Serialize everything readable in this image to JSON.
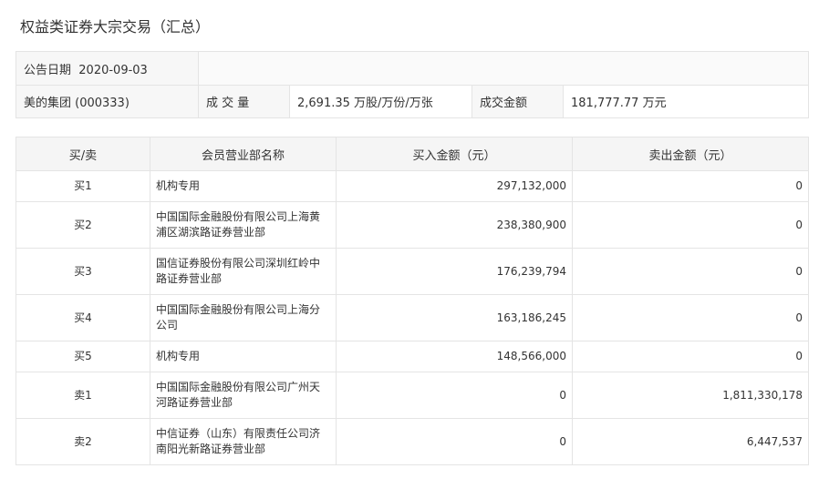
{
  "title": "权益类证券大宗交易（汇总）",
  "info": {
    "date_label": "公告日期",
    "date_value": "2020-09-03",
    "stock": "美的集团 (000333)",
    "volume_label": "成 交 量",
    "volume_value": "2,691.35 万股/万份/万张",
    "amount_label": "成交金额",
    "amount_value": "181,777.77 万元"
  },
  "table": {
    "headers": [
      "买/卖",
      "会员营业部名称",
      "买入金额（元）",
      "卖出金额（元）"
    ],
    "rows": [
      {
        "side": "买1",
        "name": "机构专用",
        "buy": "297,132,000",
        "sell": "0"
      },
      {
        "side": "买2",
        "name": "中国国际金融股份有限公司上海黄浦区湖滨路证券营业部",
        "buy": "238,380,900",
        "sell": "0"
      },
      {
        "side": "买3",
        "name": "国信证券股份有限公司深圳红岭中路证券营业部",
        "buy": "176,239,794",
        "sell": "0"
      },
      {
        "side": "买4",
        "name": "中国国际金融股份有限公司上海分公司",
        "buy": "163,186,245",
        "sell": "0"
      },
      {
        "side": "买5",
        "name": "机构专用",
        "buy": "148,566,000",
        "sell": "0"
      },
      {
        "side": "卖1",
        "name": "中国国际金融股份有限公司广州天河路证券营业部",
        "buy": "0",
        "sell": "1,811,330,178"
      },
      {
        "side": "卖2",
        "name": "中信证券（山东）有限责任公司济南阳光新路证券营业部",
        "buy": "0",
        "sell": "6,447,537"
      }
    ]
  }
}
